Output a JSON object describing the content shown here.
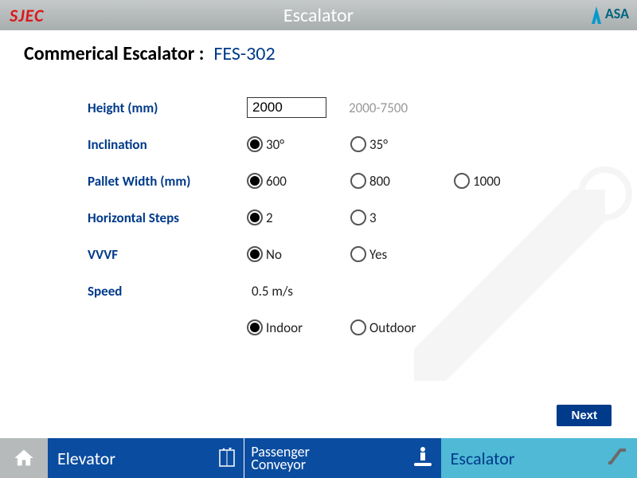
{
  "header": {
    "title": "Escalator",
    "leftLogo": "SJEC",
    "rightLogo": "ASA"
  },
  "page": {
    "titleBlack": "Commerical Escalator :",
    "titleBlue": "FES-302"
  },
  "form": {
    "height": {
      "label": "Height (mm)",
      "value": "2000",
      "hint": "2000-7500"
    },
    "inclination": {
      "label": "Inclination",
      "opt1": "30°",
      "opt2": "35°"
    },
    "pallet": {
      "label": "Pallet Width (mm)",
      "opt1": "600",
      "opt2": "800",
      "opt3": "1000"
    },
    "hsteps": {
      "label": "Horizontal Steps",
      "opt1": "2",
      "opt2": "3"
    },
    "vvvf": {
      "label": "VVVF",
      "opt1": "No",
      "opt2": "Yes"
    },
    "speed": {
      "label": "Speed",
      "value": "0.5 m/s"
    },
    "location": {
      "opt1": "Indoor",
      "opt2": "Outdoor"
    }
  },
  "buttons": {
    "next": "Next"
  },
  "nav": {
    "elevator": "Elevator",
    "conveyor1": "Passenger",
    "conveyor2": "Conveyor",
    "escalator": "Escalator"
  }
}
